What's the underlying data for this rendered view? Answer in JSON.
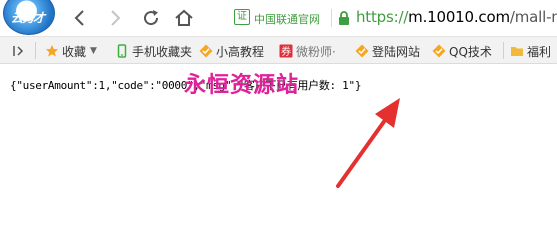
{
  "toolbar": {
    "logo_text": "云秀才",
    "back_label": "Back",
    "forward_label": "Forward",
    "reload_label": "Reload",
    "home_label": "Home"
  },
  "address_bar": {
    "cert_icon_char": "证",
    "cert_label": "中国联通官网",
    "url_scheme": "https://",
    "url_host": "m.10010.com",
    "url_path": "/mall-mo"
  },
  "bookmarks_bar": {
    "items": [
      {
        "label": "收藏",
        "icon": "star-icon",
        "color": "#f5a623"
      },
      {
        "label": "手机收藏夹",
        "icon": "phone-icon",
        "color": "#3fae3f"
      },
      {
        "label": "小高教程",
        "icon": "check-badge-icon",
        "color": "#f5a623"
      },
      {
        "label": "微粉师·",
        "icon": "ticket-icon",
        "color": "#e0313a"
      },
      {
        "label": "登陆网站",
        "icon": "check-badge-icon",
        "color": "#f5a623"
      },
      {
        "label": "QQ技术",
        "icon": "check-badge-icon",
        "color": "#f5a623"
      },
      {
        "label": "福利",
        "icon": "folder-icon",
        "color": "#f0b93a"
      }
    ]
  },
  "page": {
    "json_text": "{\"userAmount\":1,\"code\":\"0000\",\"msg\":\"客户下已有用户数: 1\"}",
    "watermark": "永恒资源站"
  },
  "colors": {
    "secure_green": "#3f9e3f",
    "watermark_magenta": "#e0219a",
    "arrow_red": "#e53030"
  }
}
